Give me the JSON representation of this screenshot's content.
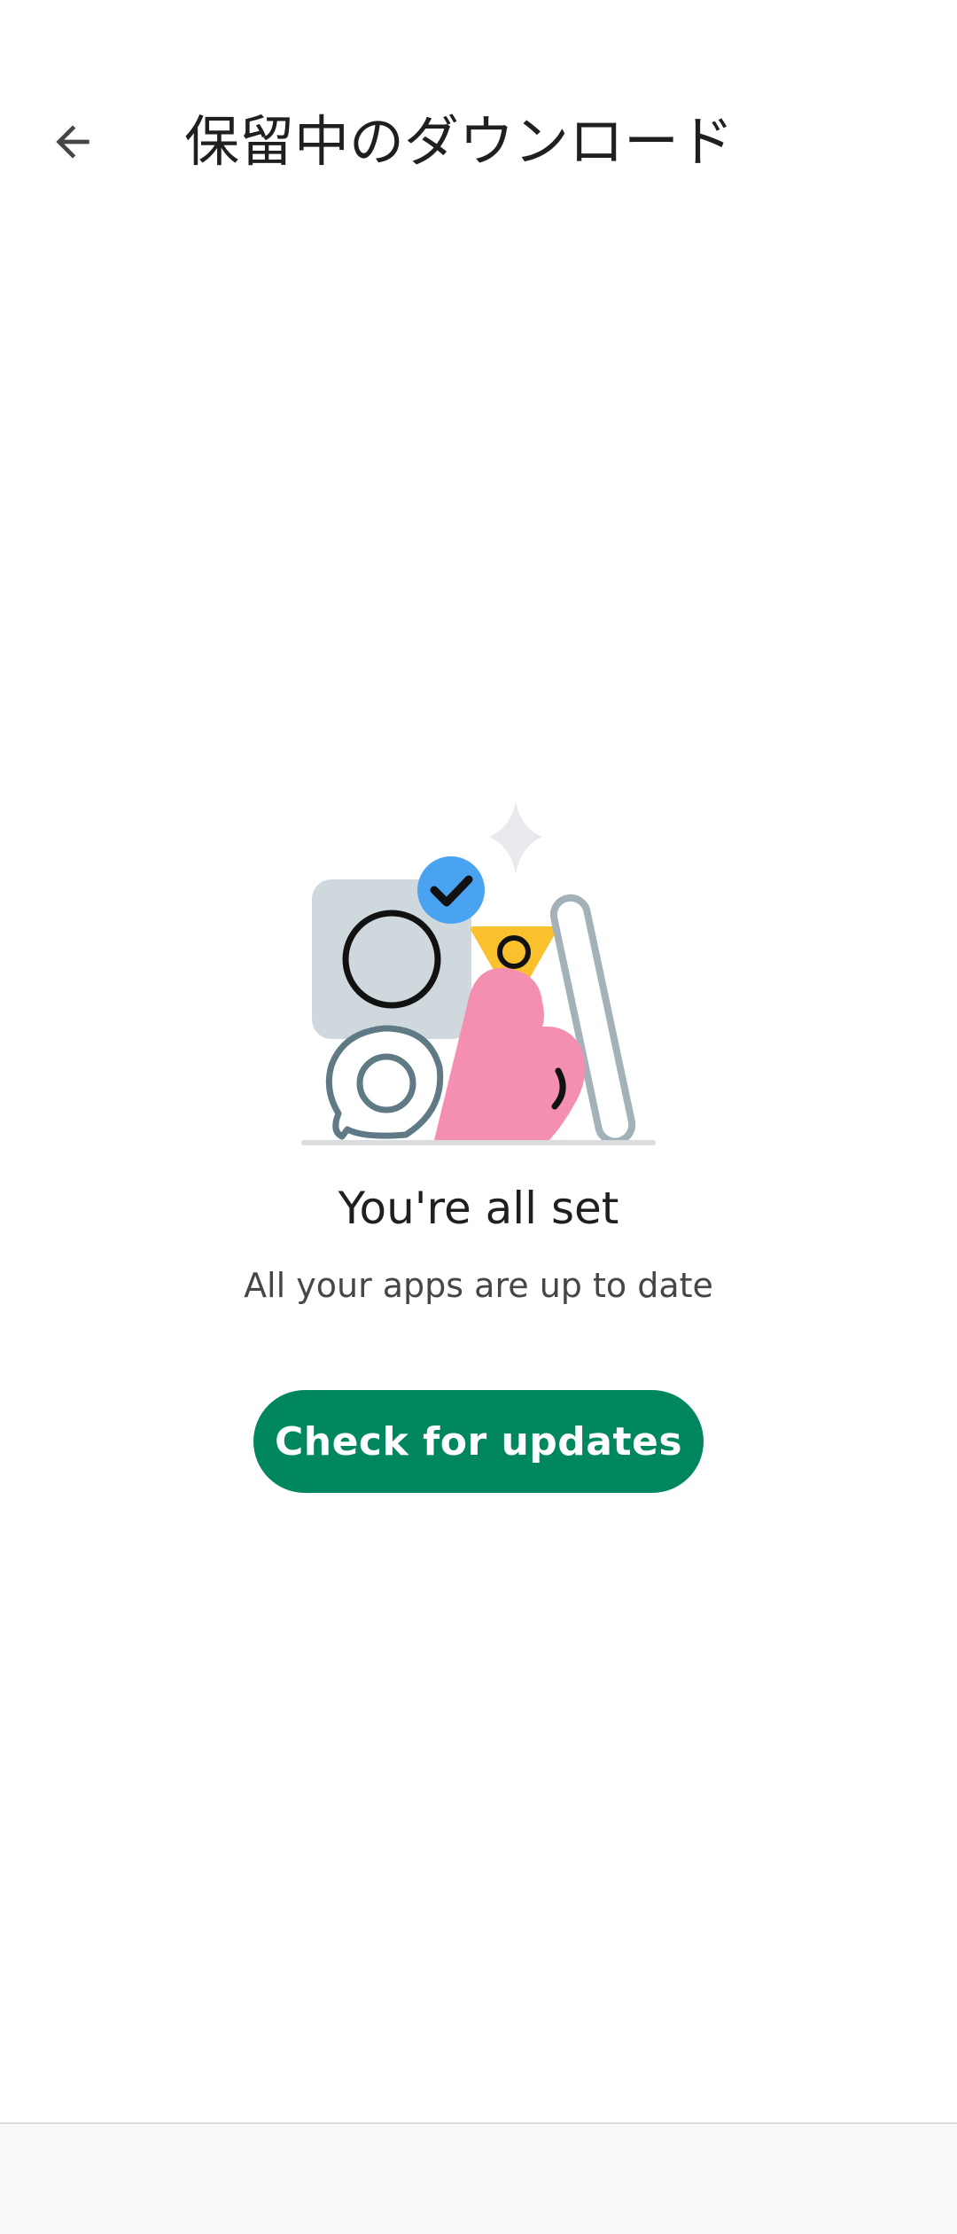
{
  "header": {
    "title": "保留中のダウンロード",
    "back_icon": "arrow-back-icon"
  },
  "empty_state": {
    "title": "You're all set",
    "subtitle": "All your apps are up to date",
    "illustration_icon": "up-to-date-illustration"
  },
  "actions": {
    "check_updates_label": "Check for updates"
  },
  "colors": {
    "accent": "#01875f",
    "text_primary": "#1f1f1f",
    "text_secondary": "#444746",
    "check_badge": "#4aa3f0",
    "heart": "#f48fb1",
    "triangle": "#fbc02d"
  }
}
